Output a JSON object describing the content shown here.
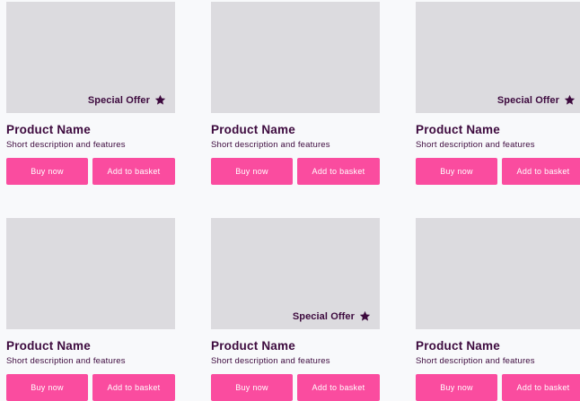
{
  "theme": {
    "accent": "#fa4c9f",
    "text": "#3d0a3e",
    "placeholder": "#dcdbdf",
    "background": "#f8f9fb"
  },
  "products": [
    {
      "title": "Product Name",
      "description": "Short description and features",
      "offer": "Special Offer",
      "buy_label": "Buy now",
      "basket_label": "Add to basket",
      "icon": "star-icon"
    },
    {
      "title": "Product Name",
      "description": "Short description and features",
      "offer": "",
      "buy_label": "Buy now",
      "basket_label": "Add to basket"
    },
    {
      "title": "Product Name",
      "description": "Short description and features",
      "offer": "Special Offer",
      "buy_label": "Buy now",
      "basket_label": "Add to basket",
      "icon": "star-icon"
    },
    {
      "title": "Product Name",
      "description": "Short description and features",
      "offer": "",
      "buy_label": "Buy now",
      "basket_label": "Add to basket"
    },
    {
      "title": "Product Name",
      "description": "Short description and features",
      "offer": "Special Offer",
      "buy_label": "Buy now",
      "basket_label": "Add to basket",
      "icon": "star-icon"
    },
    {
      "title": "Product Name",
      "description": "Short description and features",
      "offer": "",
      "buy_label": "Buy now",
      "basket_label": "Add to basket"
    }
  ]
}
